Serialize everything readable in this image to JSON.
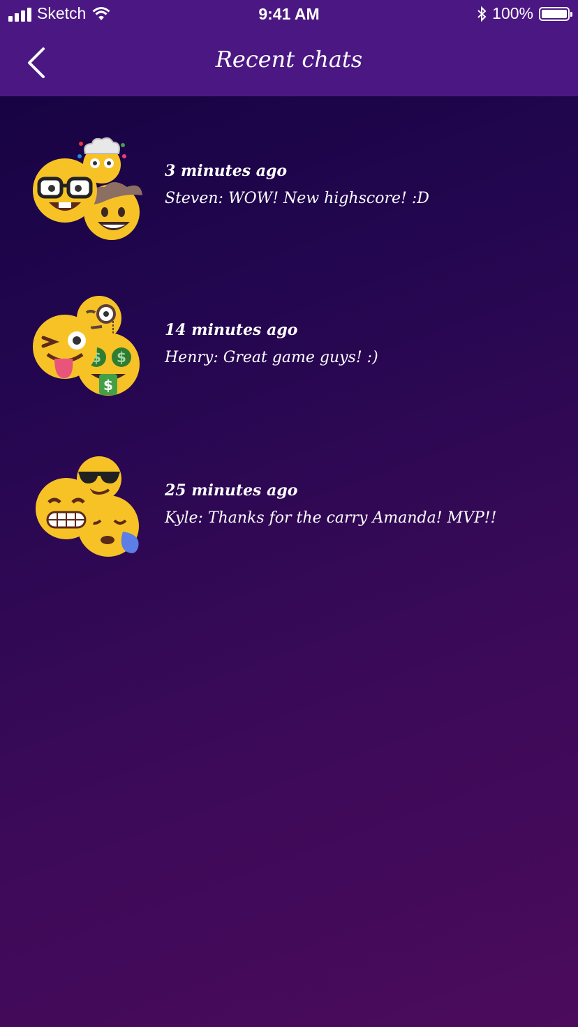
{
  "status_bar": {
    "carrier": "Sketch",
    "time": "9:41 AM",
    "battery": "100%",
    "battery_level": 1.0,
    "icons": [
      "signal-icon",
      "wifi-icon",
      "bluetooth-icon",
      "battery-icon"
    ]
  },
  "nav": {
    "title": "Recent chats",
    "back_icon": "chevron-left-icon"
  },
  "chats": [
    {
      "time": "3 minutes ago",
      "message": "Steven: WOW! New highscore! :D",
      "avatars": [
        "nerd-face-icon",
        "exploding-head-icon",
        "cowboy-face-icon"
      ]
    },
    {
      "time": "14 minutes ago",
      "message": "Henry: Great game guys! :)",
      "avatars": [
        "winking-tongue-face-icon",
        "monocle-face-icon",
        "money-mouth-face-icon"
      ]
    },
    {
      "time": "25 minutes ago",
      "message": "Kyle: Thanks for the carry Amanda! MVP!!",
      "avatars": [
        "grimacing-face-icon",
        "sunglasses-face-icon",
        "sleeping-face-icon"
      ]
    }
  ],
  "colors": {
    "header": "#4b1883",
    "bg_top": "#14033f",
    "bg_bottom": "#4c0b5c",
    "emoji_yellow": "#f7c226"
  }
}
